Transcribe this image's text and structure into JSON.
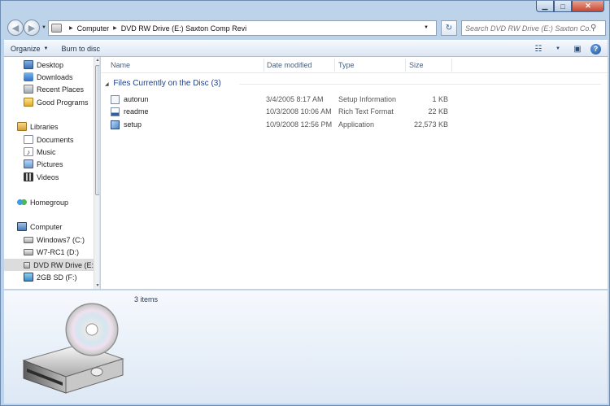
{
  "window": {
    "caption_buttons": [
      "minimize",
      "maximize",
      "close"
    ]
  },
  "address_bar": {
    "crumbs": [
      "Computer",
      "DVD RW Drive (E:) Saxton Comp Revi"
    ],
    "search_placeholder": "Search DVD RW Drive (E:) Saxton Co..."
  },
  "toolbar": {
    "organize_label": "Organize",
    "burn_label": "Burn to disc"
  },
  "nav_pane": {
    "favorites": [
      "Desktop",
      "Downloads",
      "Recent Places",
      "Good Programs"
    ],
    "libraries_label": "Libraries",
    "libraries": [
      "Documents",
      "Music",
      "Pictures",
      "Videos"
    ],
    "homegroup_label": "Homegroup",
    "computer_label": "Computer",
    "drives": [
      "Windows7 (C:)",
      "W7-RC1 (D:)",
      "DVD RW Drive (E:",
      "2GB SD (F:)"
    ]
  },
  "columns": {
    "name": "Name",
    "date": "Date modified",
    "type": "Type",
    "size": "Size"
  },
  "group": {
    "title": "Files Currently on the Disc (3)"
  },
  "files": [
    {
      "name": "autorun",
      "date": "3/4/2005 8:17 AM",
      "type": "Setup Information",
      "size": "1 KB",
      "icon": "settings-file-icon"
    },
    {
      "name": "readme",
      "date": "10/3/2008 10:06 AM",
      "type": "Rich Text Format",
      "size": "22 KB",
      "icon": "rtf-document-icon"
    },
    {
      "name": "setup",
      "date": "10/9/2008 12:56 PM",
      "type": "Application",
      "size": "22,573 KB",
      "icon": "application-icon"
    }
  ],
  "details": {
    "items_count": "3 items"
  }
}
